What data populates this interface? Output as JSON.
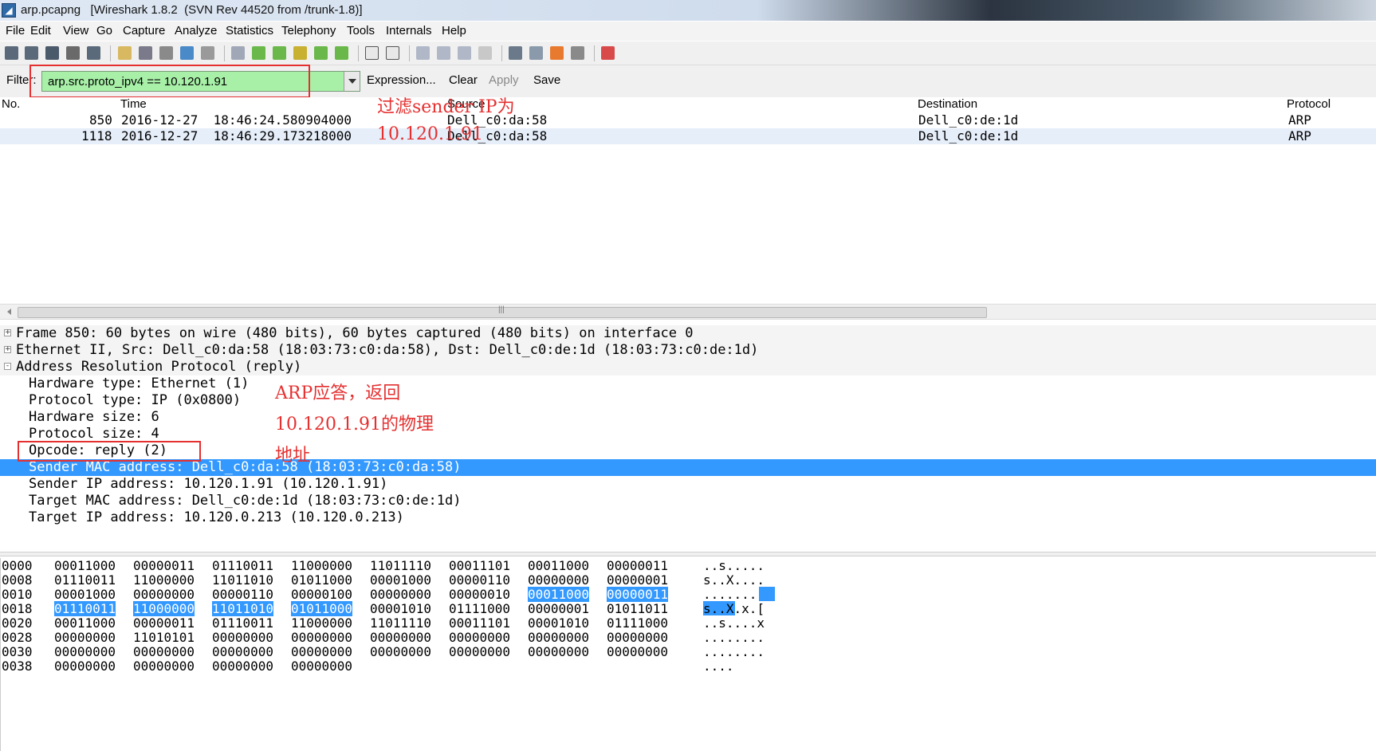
{
  "window": {
    "title": "arp.pcapng   [Wireshark 1.8.2  (SVN Rev 44520 from /trunk-1.8)]"
  },
  "menu": [
    "File",
    "Edit",
    "View",
    "Go",
    "Capture",
    "Analyze",
    "Statistics",
    "Telephony",
    "Tools",
    "Internals",
    "Help"
  ],
  "toolbar_icons": [
    "interface-list-icon",
    "capture-options-icon",
    "start-capture-icon",
    "stop-capture-icon",
    "restart-capture-icon",
    "open-icon",
    "save-icon",
    "close-icon",
    "reload-icon",
    "print-icon",
    "find-icon",
    "go-back-icon",
    "go-forward-icon",
    "go-to-packet-icon",
    "first-packet-icon",
    "last-packet-icon",
    "colorize-icon",
    "autoscroll-icon",
    "zoom-in-icon",
    "zoom-out-icon",
    "normal-size-icon",
    "resize-columns-icon",
    "capture-filters-icon",
    "display-filters-icon",
    "coloring-rules-icon",
    "preferences-icon",
    "help-icon"
  ],
  "filter": {
    "label": "Filter:",
    "value": "arp.src.proto_ipv4 == 10.120.1.91",
    "actions": [
      "Expression...",
      "Clear",
      "Apply",
      "Save"
    ],
    "color": "#a8f0a8"
  },
  "annotations": {
    "filter_note_1": "过滤sender IP为",
    "filter_note_2": "10.120.1.91",
    "arp_note_1": "ARP应答，返回",
    "arp_note_2": "10.120.1.91的物理",
    "arp_note_3": "地址",
    "color": "#e53030"
  },
  "packet_list": {
    "columns": [
      "No.",
      "Time",
      "Source",
      "Destination",
      "Protocol"
    ],
    "rows": [
      {
        "no": "850",
        "time": "2016-12-27  18:46:24.580904000",
        "source": "Dell_c0:da:58",
        "destination": "Dell_c0:de:1d",
        "protocol": "ARP"
      },
      {
        "no": "1118",
        "time": "2016-12-27  18:46:29.173218000",
        "source": "Dell_c0:da:58",
        "destination": "Dell_c0:de:1d",
        "protocol": "ARP"
      }
    ]
  },
  "details": [
    {
      "text": "Frame 850: 60 bytes on wire (480 bits), 60 bytes captured (480 bits) on interface 0",
      "expander": "+"
    },
    {
      "text": "Ethernet II, Src: Dell_c0:da:58 (18:03:73:c0:da:58), Dst: Dell_c0:de:1d (18:03:73:c0:de:1d)",
      "expander": "+"
    },
    {
      "text": "Address Resolution Protocol (reply)",
      "expander": "-"
    },
    {
      "text": "Hardware type: Ethernet (1)"
    },
    {
      "text": "Protocol type: IP (0x0800)"
    },
    {
      "text": "Hardware size: 6"
    },
    {
      "text": "Protocol size: 4"
    },
    {
      "text": "Opcode: reply (2)"
    },
    {
      "text": "Sender MAC address: Dell_c0:da:58 (18:03:73:c0:da:58)",
      "selected": true
    },
    {
      "text": "Sender IP address: 10.120.1.91 (10.120.1.91)"
    },
    {
      "text": "Target MAC address: Dell_c0:de:1d (18:03:73:c0:de:1d)"
    },
    {
      "text": "Target IP address: 10.120.0.213 (10.120.0.213)"
    }
  ],
  "bytes": [
    {
      "offset": "0000",
      "groups": [
        "00011000",
        "00000011",
        "01110011",
        "11000000",
        "11011110",
        "00011101",
        "00011000",
        "00000011"
      ],
      "ascii": "..s....."
    },
    {
      "offset": "0008",
      "groups": [
        "01110011",
        "11000000",
        "11011010",
        "01011000",
        "00001000",
        "00000110",
        "00000000",
        "00000001"
      ],
      "ascii": "s..X...."
    },
    {
      "offset": "0010",
      "groups": [
        "00001000",
        "00000000",
        "00000110",
        "00000100",
        "00000000",
        "00000010",
        "00011000",
        "00000011"
      ],
      "ascii": "........"
    },
    {
      "offset": "0018",
      "groups": [
        "01110011",
        "11000000",
        "11011010",
        "01011000",
        "00001010",
        "01111000",
        "00000001",
        "01011011"
      ],
      "ascii": "s..X.x.["
    },
    {
      "offset": "0020",
      "groups": [
        "00011000",
        "00000011",
        "01110011",
        "11000000",
        "11011110",
        "00011101",
        "00001010",
        "01111000"
      ],
      "ascii": "..s....x"
    },
    {
      "offset": "0028",
      "groups": [
        "00000000",
        "11010101",
        "00000000",
        "00000000",
        "00000000",
        "00000000",
        "00000000",
        "00000000"
      ],
      "ascii": "........"
    },
    {
      "offset": "0030",
      "groups": [
        "00000000",
        "00000000",
        "00000000",
        "00000000",
        "00000000",
        "00000000",
        "00000000",
        "00000000"
      ],
      "ascii": "........"
    },
    {
      "offset": "0038",
      "groups": [
        "00000000",
        "00000000",
        "00000000",
        "00000000"
      ],
      "ascii": "...."
    }
  ],
  "highlight_color": "#3399ff"
}
